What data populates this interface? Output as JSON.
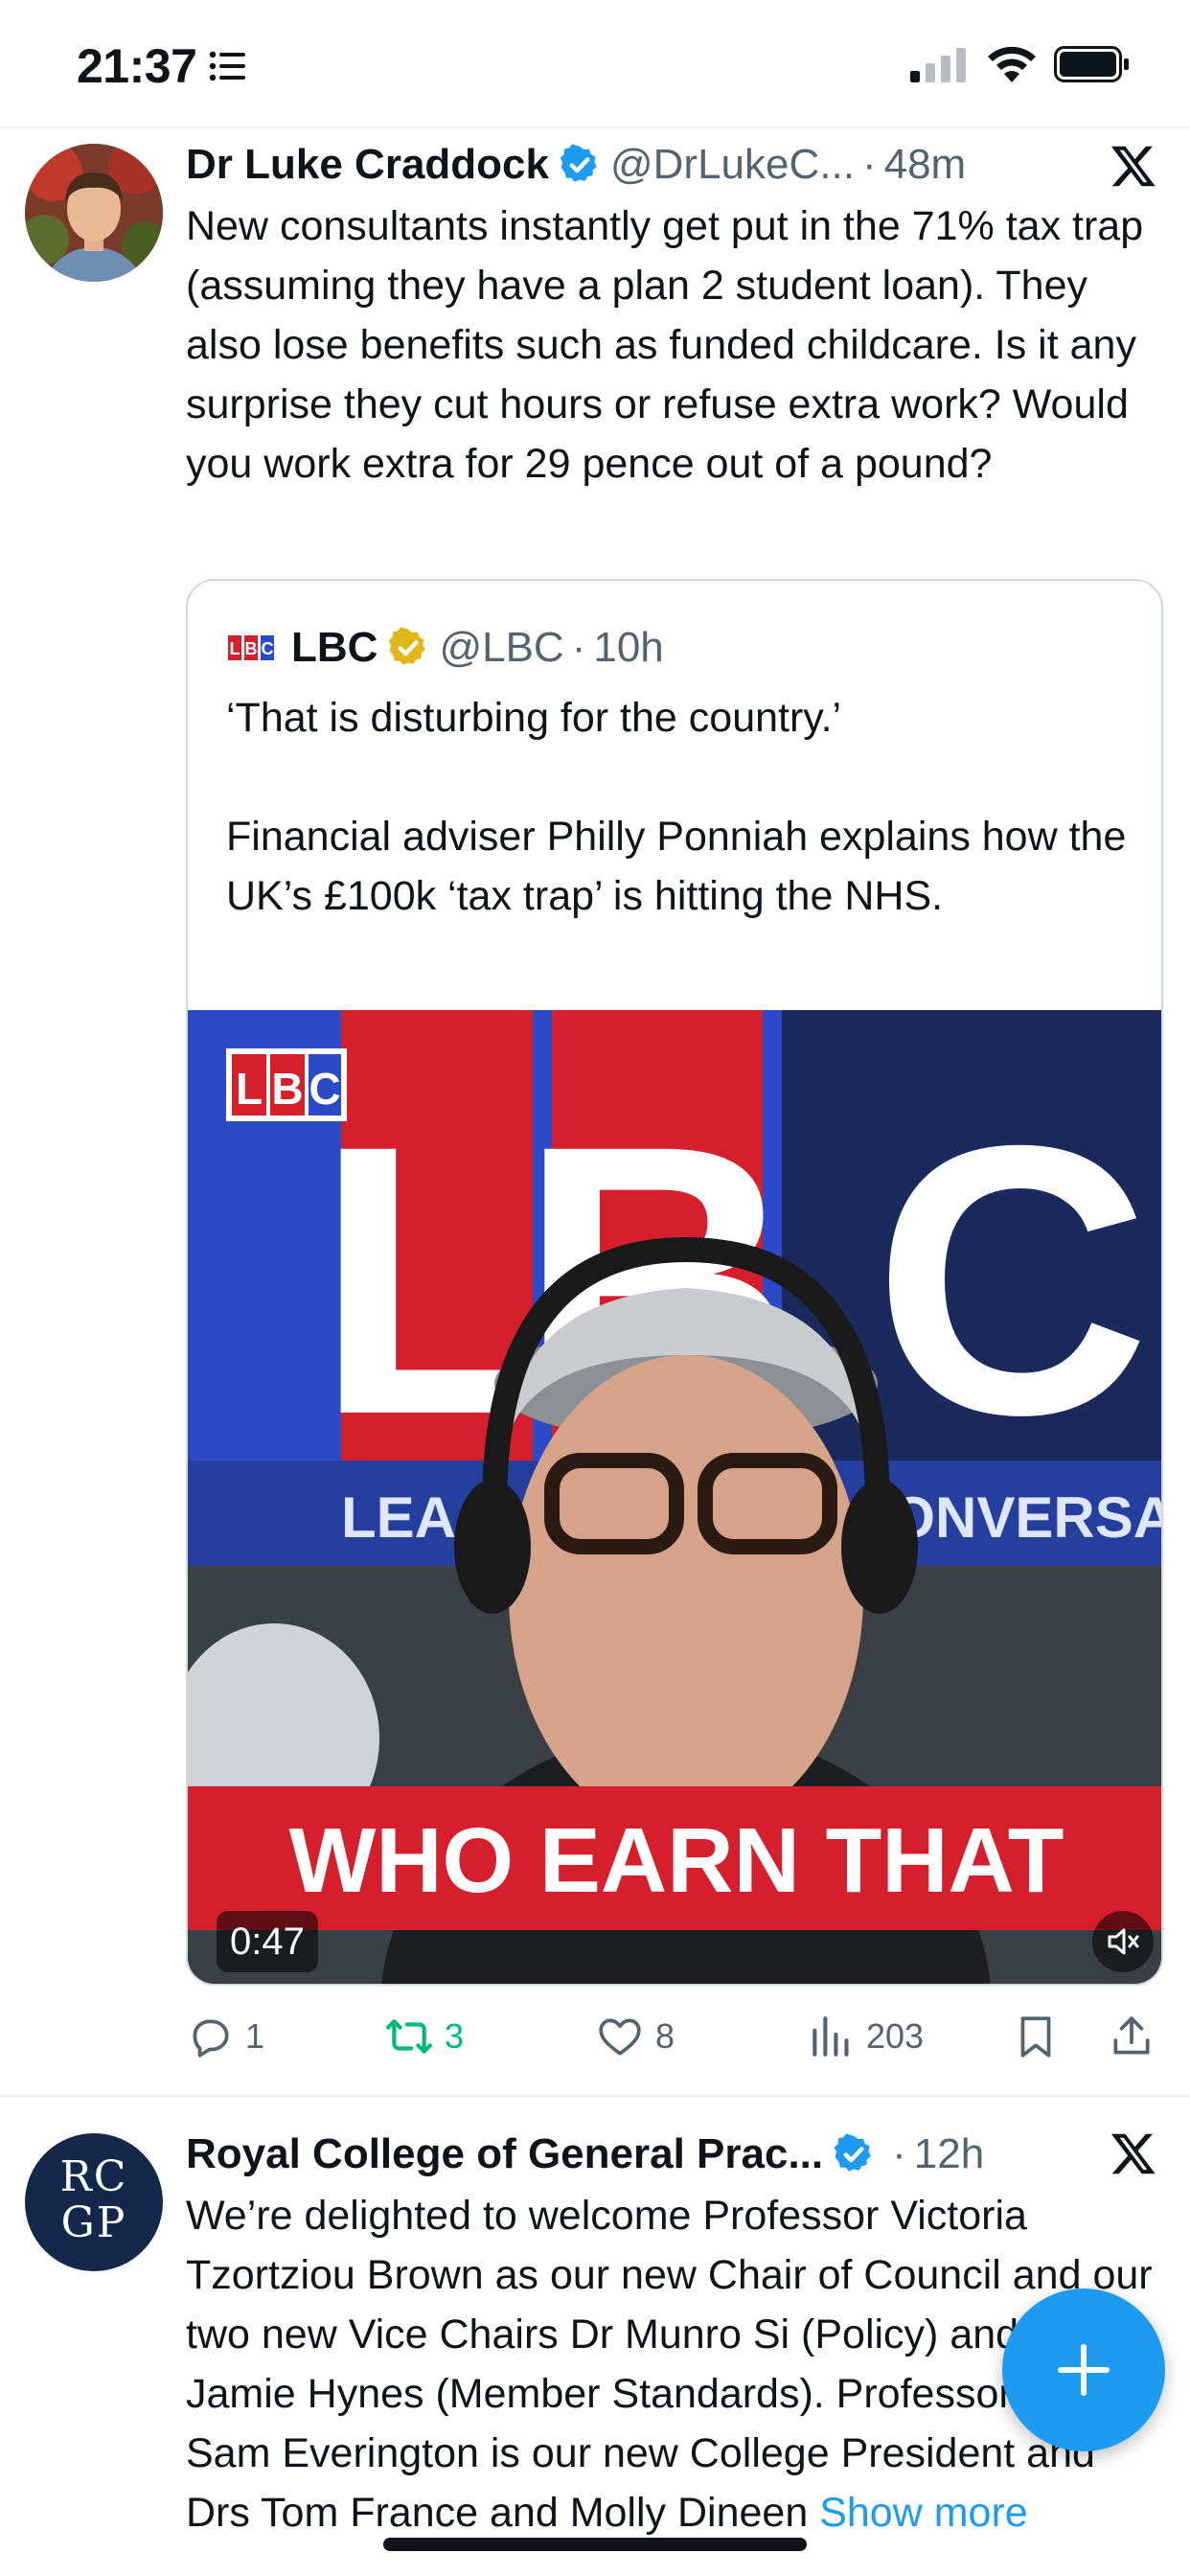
{
  "status_bar": {
    "time": "21:37",
    "icons": [
      "list-icon",
      "signal-icon",
      "wifi-icon",
      "battery-icon"
    ]
  },
  "tweet1": {
    "name": "Dr Luke Craddock",
    "handle": "@DrLukeC...",
    "separator": "·",
    "time": "48m",
    "body": "New consultants instantly get put in the 71% tax trap (assuming they have a plan 2 student loan). They also lose benefits such as funded childcare. Is it any surprise they cut hours or refuse extra work? Would you work extra for 29 pence out of a pound?",
    "quote": {
      "name": "LBC",
      "handle": "@LBC",
      "separator": "·",
      "time": "10h",
      "body": "‘That is disturbing for the country.’\n\nFinancial adviser Philly Ponniah explains how the UK’s £100k ‘tax trap’ is hitting the NHS.",
      "video": {
        "logo_text": "LBC",
        "tagline": "LEA",
        "tagline_right": "CONVERSATI",
        "caption": "WHO EARN THAT",
        "duration": "0:47"
      }
    },
    "actions": {
      "replies": "1",
      "reposts": "3",
      "likes": "8",
      "views": "203"
    }
  },
  "tweet2": {
    "avatar_text_line1": "RC",
    "avatar_text_line2": "GP",
    "name": "Royal College of General Prac...",
    "separator": "·",
    "time": "12h",
    "body": "We’re delighted to welcome Professor Victoria Tzortziou Brown as our new Chair of Council and our two new Vice Chairs Dr Munro Si (Policy) and Dr Jamie Hynes (Member Standards). Professor Sir Sam Everington is our new College President and Drs Tom France and Molly Dineen",
    "show_more": "Show more"
  },
  "colors": {
    "accent": "#1d9bf0",
    "repost_green": "#00ba7c",
    "text_secondary": "#536471",
    "verified_gold": "#e2b719",
    "lbc_red": "#d61f2c",
    "lbc_blue": "#2c4ac7"
  }
}
